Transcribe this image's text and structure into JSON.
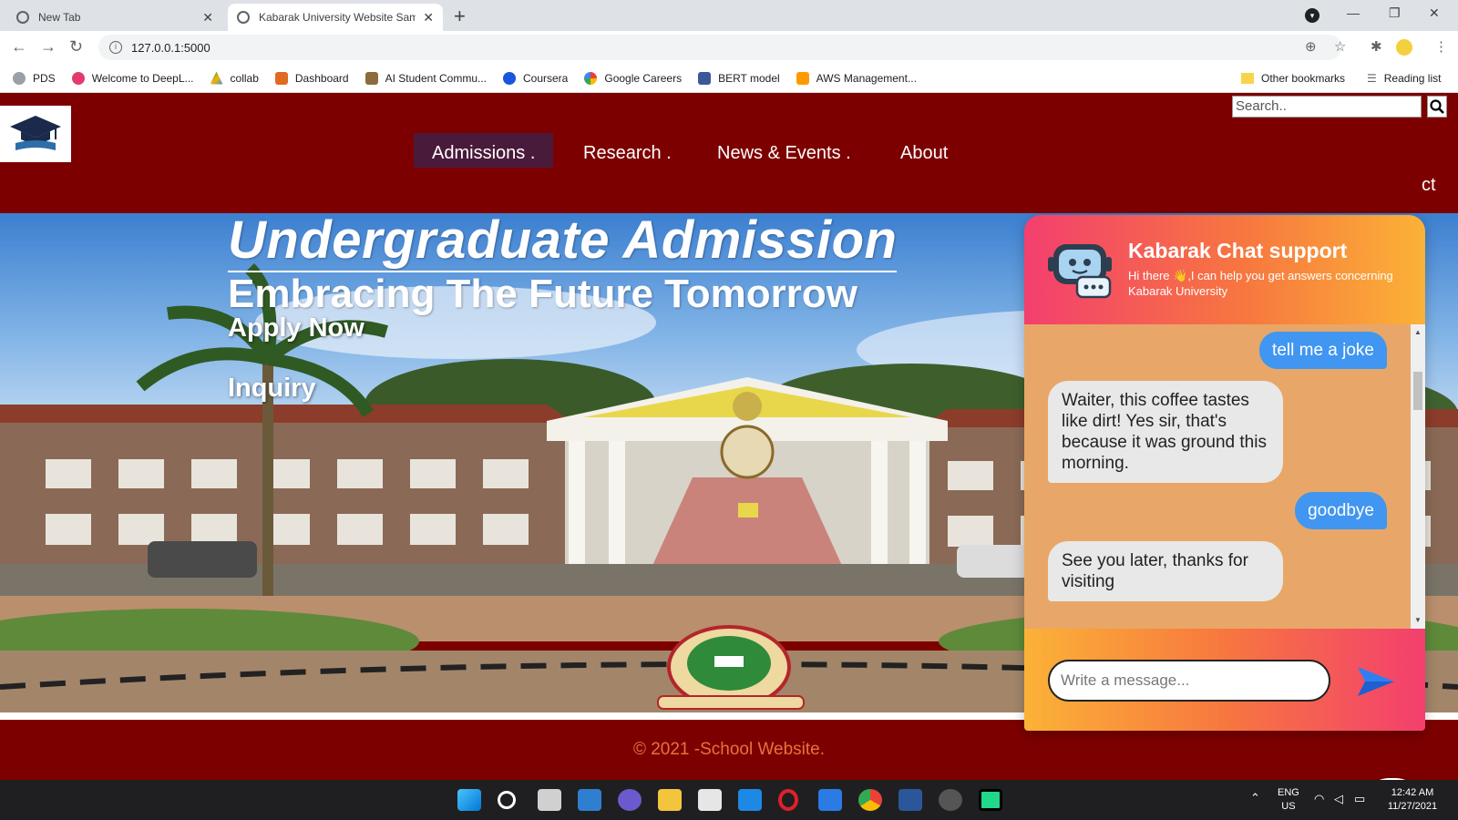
{
  "browser": {
    "tabs": [
      {
        "title": "New Tab",
        "active": false
      },
      {
        "title": "Kabarak University Website Samp",
        "active": true
      }
    ],
    "url": "127.0.0.1:5000",
    "bookmarks": [
      {
        "label": "PDS",
        "color": "#5f6368"
      },
      {
        "label": "Welcome to DeepL...",
        "color": "#e33b6e"
      },
      {
        "label": "collab",
        "color": "#f4b400"
      },
      {
        "label": "Dashboard",
        "color": "#e06a24"
      },
      {
        "label": "AI Student Commu...",
        "color": "#8a6d3b"
      },
      {
        "label": "Coursera",
        "color": "#1a56db"
      },
      {
        "label": "Google Careers",
        "color": "#4285f4"
      },
      {
        "label": "BERT model",
        "color": "#3b5998"
      },
      {
        "label": "AWS Management...",
        "color": "#ff9900"
      }
    ],
    "other_bookmarks": "Other bookmarks",
    "reading_list": "Reading list"
  },
  "site": {
    "search_placeholder": "Search..",
    "nav": [
      {
        "label": "Admissions .",
        "active": true
      },
      {
        "label": "Research .",
        "active": false
      },
      {
        "label": "News & Events .",
        "active": false
      },
      {
        "label": "About",
        "active": false
      }
    ],
    "nav_clipped": "ct",
    "hero": {
      "title": "Undergraduate Admission",
      "subtitle": "Embracing The Future Tomorrow",
      "apply": "Apply Now",
      "inquiry": "Inquiry"
    },
    "footer": "© 2021 -School Website.",
    "colors": {
      "brand": "#7d0000",
      "footer_text": "#e3743d"
    }
  },
  "chat": {
    "title": "Kabarak Chat support",
    "description": "Hi there 👋,I can help you get answers concerning Kabarak University",
    "messages": [
      {
        "from": "user",
        "text": "tell me a joke"
      },
      {
        "from": "bot",
        "text": "Waiter, this coffee tastes like dirt! Yes sir, that's because it was ground this morning."
      },
      {
        "from": "user",
        "text": "goodbye"
      },
      {
        "from": "bot",
        "text": "See you later, thanks for visiting"
      }
    ],
    "input_placeholder": "Write a message...",
    "colors": {
      "user_bubble": "#4096f0",
      "bot_bubble": "#e8e8e8",
      "body": "#e8a768"
    }
  },
  "taskbar": {
    "lang": "ENG",
    "region": "US",
    "time": "12:42 AM",
    "date": "11/27/2021"
  }
}
